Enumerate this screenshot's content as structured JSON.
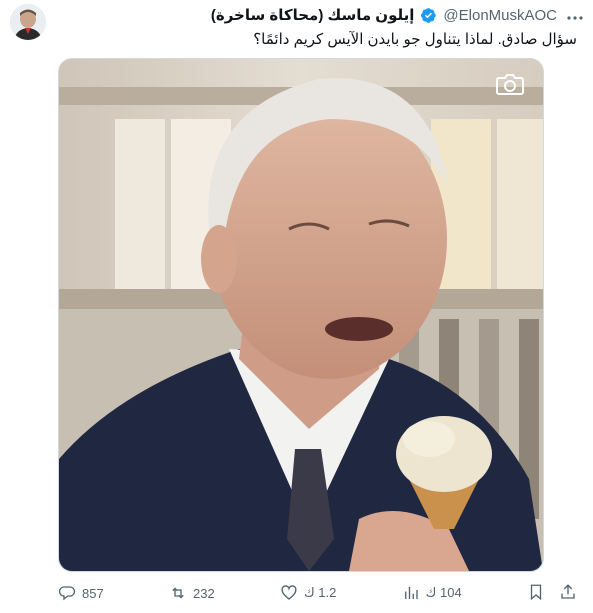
{
  "author": {
    "display_name": "إيلون ماسك (محاكاة ساخرة)",
    "handle": "@ElonMuskAOC",
    "verified": true
  },
  "tweet": {
    "text": "سؤال صادق. لماذا يتناول جو بايدن الآيس كريم دائمًا؟"
  },
  "media": {
    "type": "photo",
    "icon": "camera-icon"
  },
  "actions": {
    "replies": "857",
    "reposts": "232",
    "likes": "1.2 ك",
    "views": "104 ك",
    "bookmark_icon": "bookmark-icon",
    "share_icon": "share-icon"
  },
  "colors": {
    "accent": "#1d9bf0",
    "muted": "#536471",
    "text": "#0f1419"
  }
}
